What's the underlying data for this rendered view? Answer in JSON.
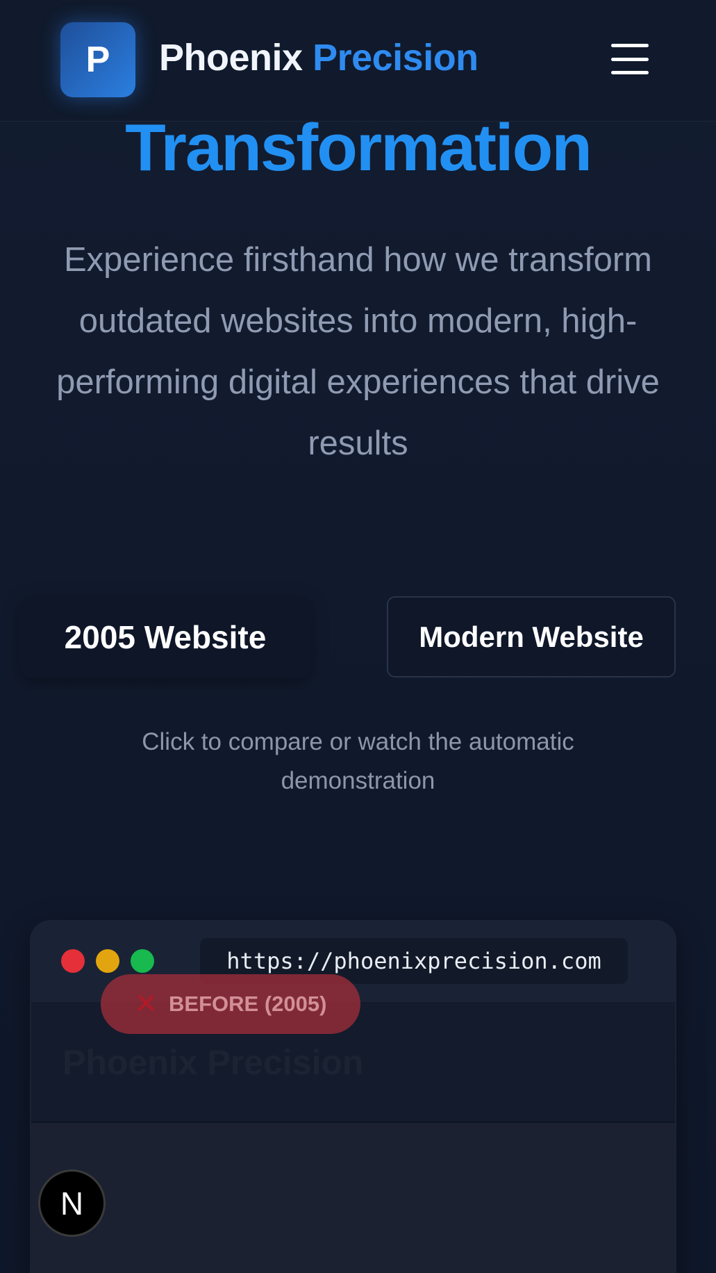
{
  "header": {
    "logo_letter": "P",
    "brand_part1": "Phoenix",
    "brand_part2": "Precision",
    "menu_icon": "hamburger-menu-icon"
  },
  "hero": {
    "title": "Transformation",
    "subtitle": "Experience firsthand how we transform outdated websites into modern, high-performing digital experiences that drive results"
  },
  "toggle": {
    "old_label": "2005 Website",
    "new_label": "Modern Website",
    "hint": "Click to compare or watch the automatic demonstration"
  },
  "browser": {
    "url": "https://phoenixprecision.com",
    "badge_icon": "✕",
    "badge_label": "BEFORE (2005)",
    "old_site_title": "Phoenix Precision"
  },
  "overlay": {
    "next_badge_letter": "N"
  },
  "colors": {
    "accent": "#2f8bf0",
    "background": "#111a2e",
    "dot_red": "#e5303a",
    "dot_yellow": "#e2a50f",
    "dot_green": "#18b94e"
  }
}
